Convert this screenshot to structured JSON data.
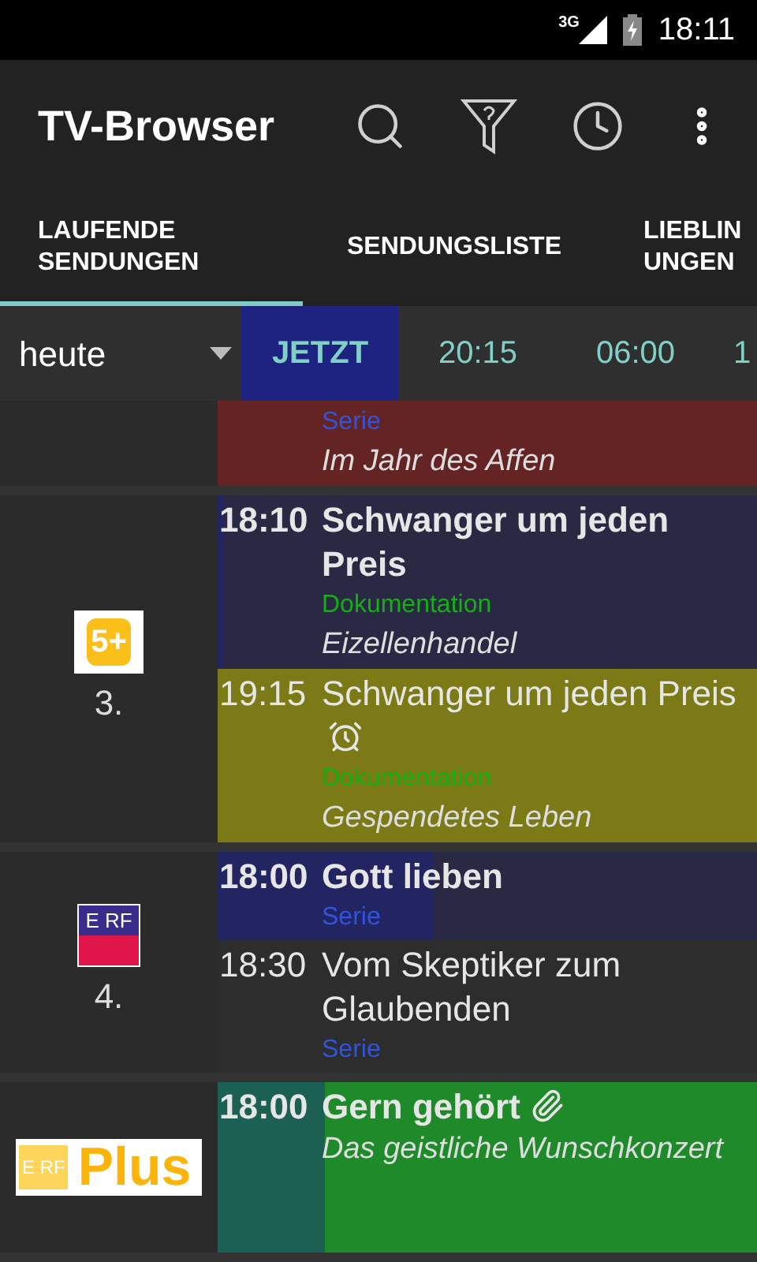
{
  "status_bar": {
    "network": "3G",
    "time": "18:11"
  },
  "app_bar": {
    "title": "TV-Browser"
  },
  "tabs": [
    {
      "label": "LAUFENDE SENDUNGEN",
      "selected": true
    },
    {
      "label": "SENDUNGSLISTE",
      "selected": false
    },
    {
      "label": "LIEBLIN UNGEN",
      "selected": false
    }
  ],
  "time_bar": {
    "day": "heute",
    "times": [
      {
        "label": "JETZT",
        "selected": true
      },
      {
        "label": "20:15",
        "selected": false
      },
      {
        "label": "06:00",
        "selected": false
      },
      {
        "label": "1",
        "selected": false
      }
    ]
  },
  "channels": [
    {
      "programs": [
        {
          "genre": {
            "label": "Serie",
            "color": "#2f55e0"
          },
          "episode": "Im Jahr des Affen",
          "color": "#642424"
        }
      ]
    },
    {
      "number": "3.",
      "logo": "5+",
      "programs": [
        {
          "time": "18:10",
          "title": "Schwanger um jeden Preis",
          "level": 0.01,
          "genre": {
            "label": "Dokumentation",
            "color": "#12b012"
          },
          "episode": "Eizellenhandel",
          "color": "#2a2944"
        },
        {
          "time": "19:15",
          "title": "Schwanger um jeden Preis",
          "genre": {
            "label": "Dokumentation",
            "color": "#12b012"
          },
          "episode": "Gespendetes Leben",
          "color": "#7b7a16",
          "reminder": true
        }
      ]
    },
    {
      "number": "4.",
      "logo": "E RF",
      "programs": [
        {
          "time": "18:00",
          "title": "Gott lieben",
          "level": 0.4,
          "genre": {
            "label": "Serie",
            "color": "#2f55e0"
          },
          "color": "#2a2944"
        },
        {
          "time": "18:30",
          "title": "Vom Skeptiker zum Glaubenden",
          "genre": {
            "label": "Serie",
            "color": "#2f55e0"
          },
          "color": "#2d2d2d"
        }
      ]
    },
    {
      "logo": "E RF Plus",
      "programs": [
        {
          "time": "18:00",
          "title": "Gern gehört",
          "level": 0.2,
          "episode": "Das geistliche Wunschkonzert",
          "color": "#1f8a2a",
          "attachment": true
        }
      ]
    }
  ]
}
